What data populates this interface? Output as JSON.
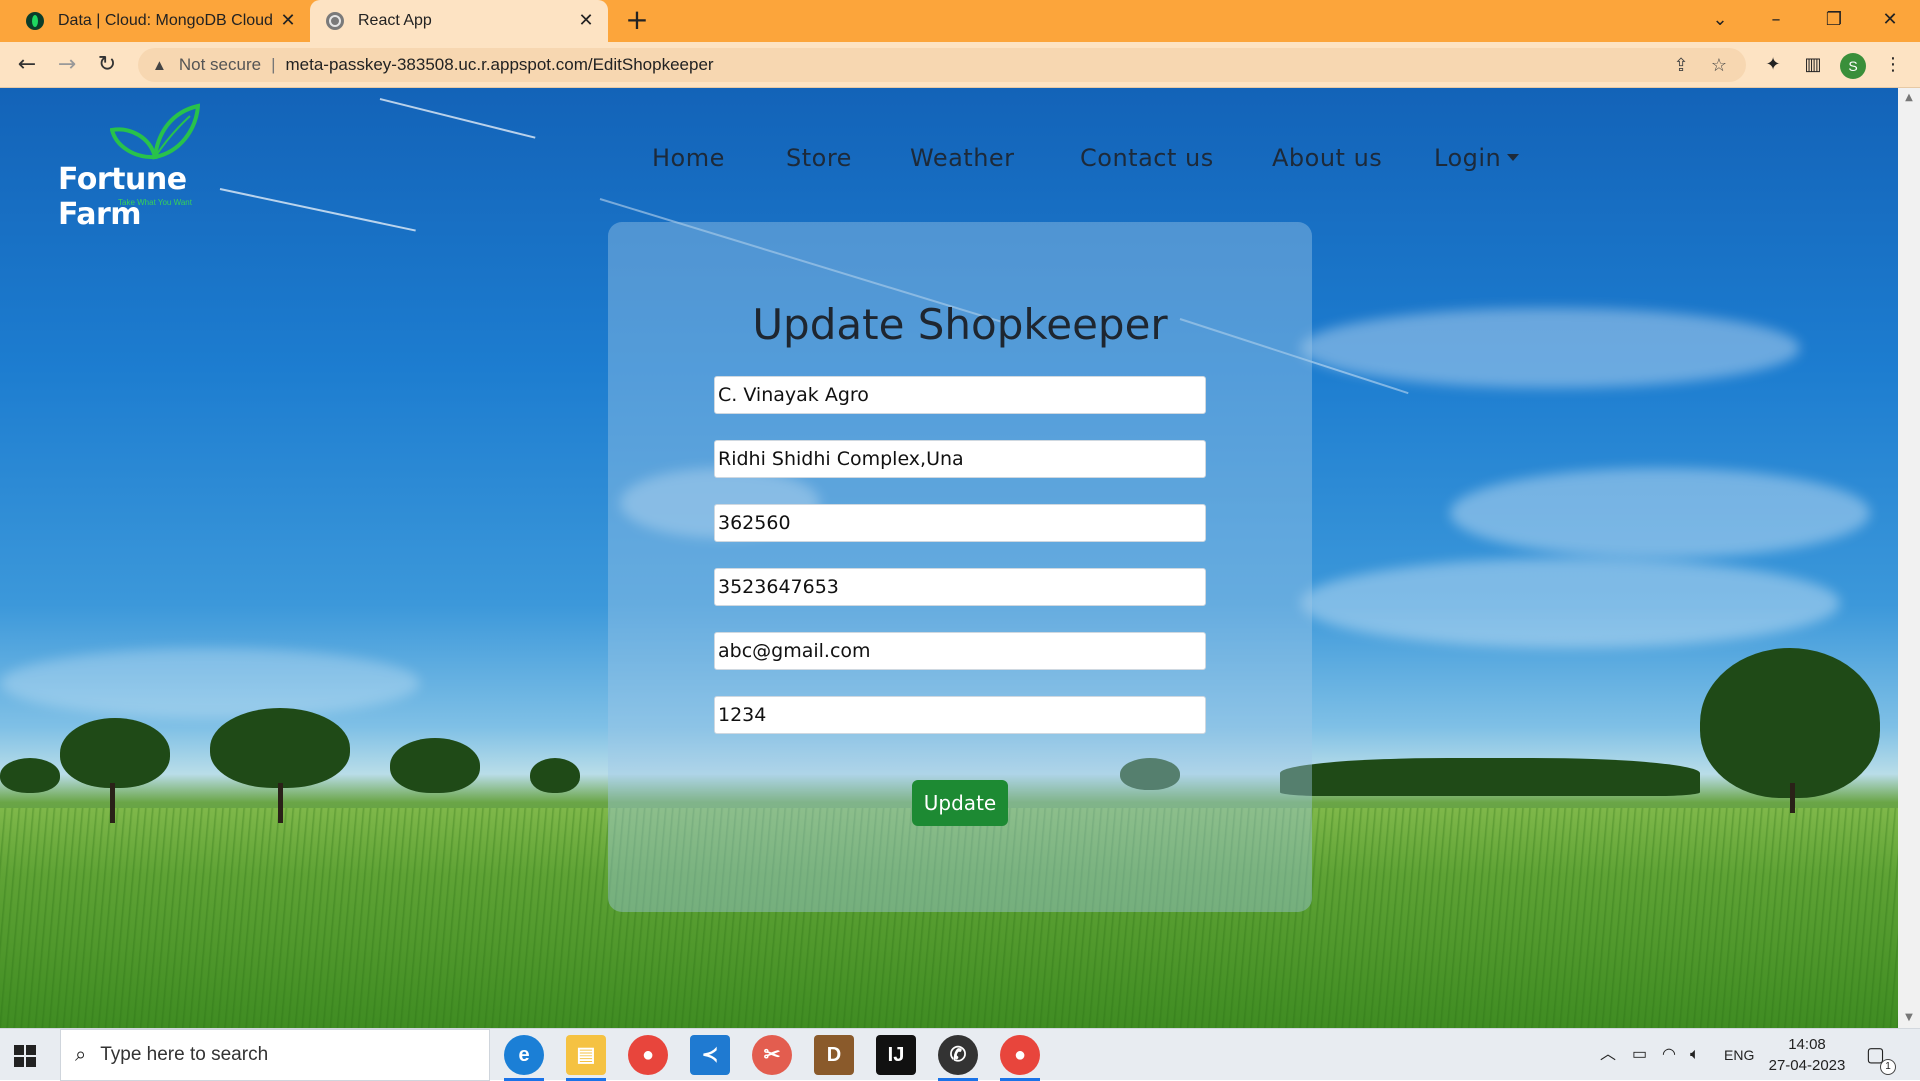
{
  "browser": {
    "tabs": [
      {
        "title": "Data | Cloud: MongoDB Cloud",
        "favicon": "mongodb-leaf-icon"
      },
      {
        "title": "React App",
        "favicon": "globe-icon"
      }
    ],
    "security_label": "Not secure",
    "url": "meta-passkey-383508.uc.r.appspot.com/EditShopkeeper",
    "profile_initial": "S",
    "accent_color": "#fca53b"
  },
  "site": {
    "brand": "Fortune Farm",
    "tagline": "Take What You Want",
    "nav": [
      {
        "label": "Home"
      },
      {
        "label": "Store"
      },
      {
        "label": "Weather"
      },
      {
        "label": "Contact us"
      },
      {
        "label": "About us"
      },
      {
        "label": "Login"
      }
    ]
  },
  "form": {
    "title": "Update Shopkeeper",
    "fields": [
      {
        "value": "C. Vinayak Agro"
      },
      {
        "value": "Ridhi Shidhi Complex,Una"
      },
      {
        "value": "362560"
      },
      {
        "value": "3523647653"
      },
      {
        "value": "abc@gmail.com"
      },
      {
        "value": "1234"
      }
    ],
    "submit_label": "Update",
    "submit_color": "#1d8a33"
  },
  "taskbar": {
    "search_placeholder": "Type here to search",
    "language": "ENG",
    "time": "14:08",
    "date": "27-04-2023",
    "notification_count": "1"
  }
}
